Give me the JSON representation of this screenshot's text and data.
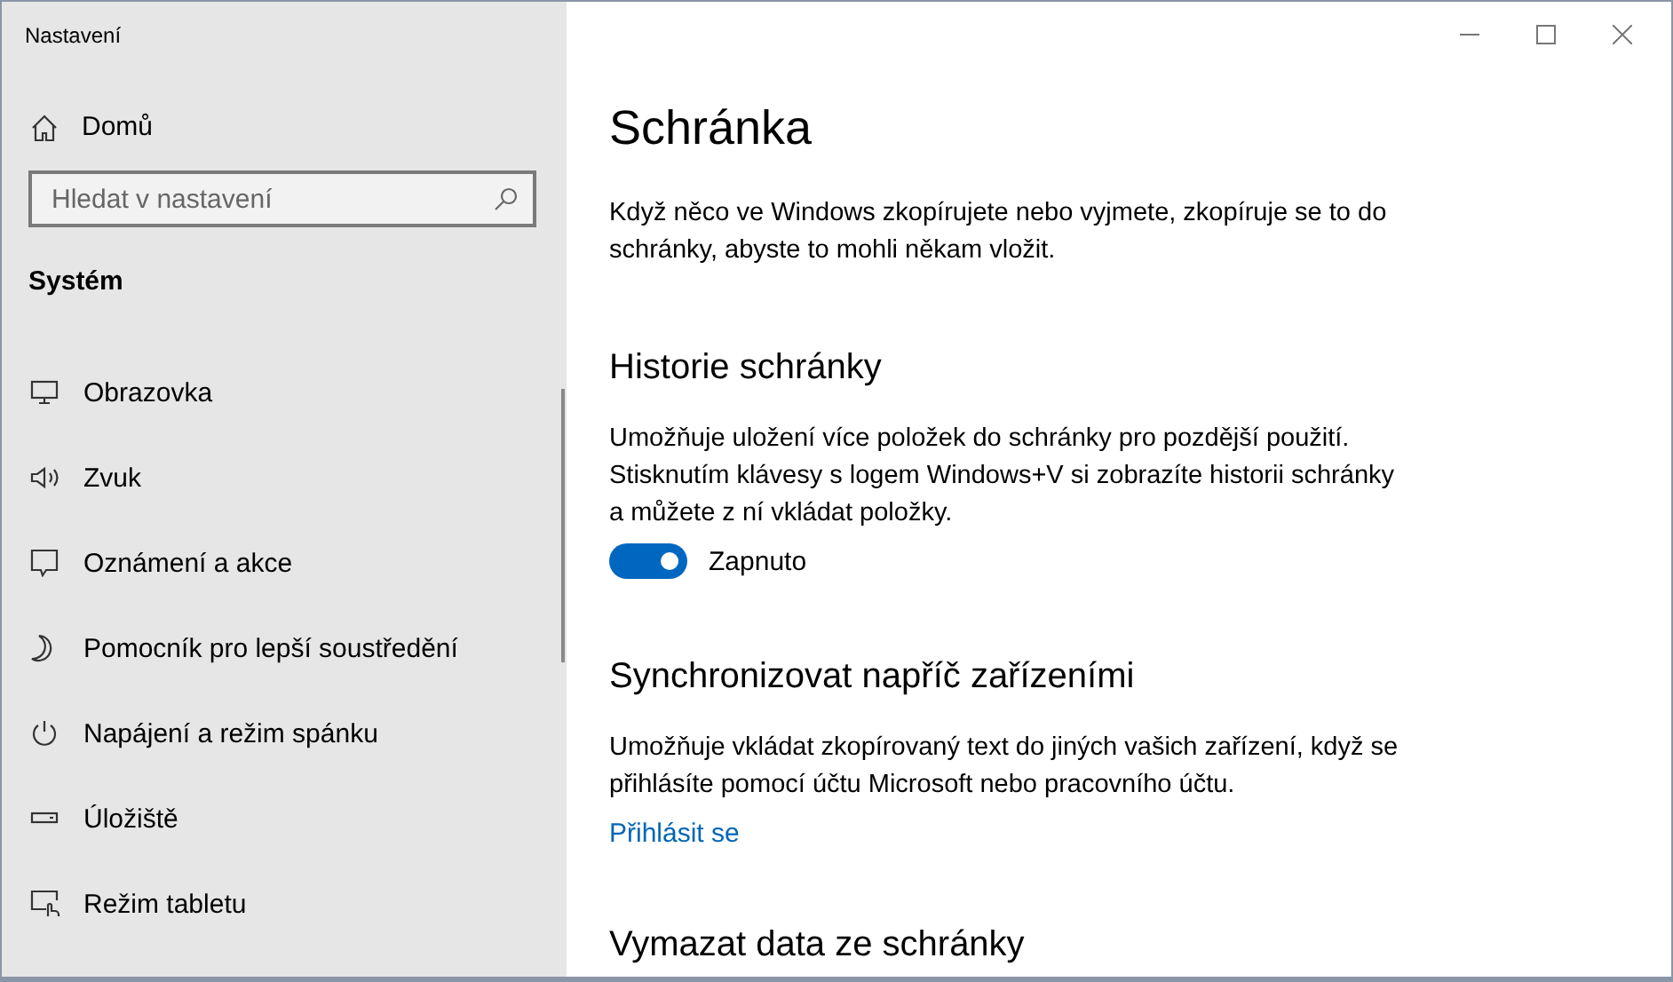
{
  "window": {
    "title": "Nastavení"
  },
  "sidebar": {
    "home": "Domů",
    "search": {
      "placeholder": "Hledat v nastavení"
    },
    "section": "Systém",
    "items": [
      {
        "label": "Obrazovka"
      },
      {
        "label": "Zvuk"
      },
      {
        "label": "Oznámení a akce"
      },
      {
        "label": "Pomocník pro lepší soustředění"
      },
      {
        "label": "Napájení a režim spánku"
      },
      {
        "label": "Úložiště"
      },
      {
        "label": "Režim tabletu"
      }
    ]
  },
  "page": {
    "title": "Schránka",
    "intro": "Když něco ve Windows zkopírujete nebo vyjmete, zkopíruje se to do schránky, abyste to mohli někam vložit.",
    "sections": [
      {
        "heading": "Historie schránky",
        "text": "Umožňuje uložení více položek do schránky pro pozdější použití. Stisknutím klávesy s logem Windows+V si zobrazíte historii schránky a můžete z ní vkládat položky.",
        "toggle": {
          "on": true,
          "label": "Zapnuto"
        }
      },
      {
        "heading": "Synchronizovat napříč zařízeními",
        "text": "Umožňuje vkládat zkopírovaný text do jiných vašich zařízení, když se přihlásíte pomocí účtu Microsoft nebo pracovního účtu.",
        "link": "Přihlásit se"
      },
      {
        "heading": "Vymazat data ze schránky"
      }
    ]
  }
}
